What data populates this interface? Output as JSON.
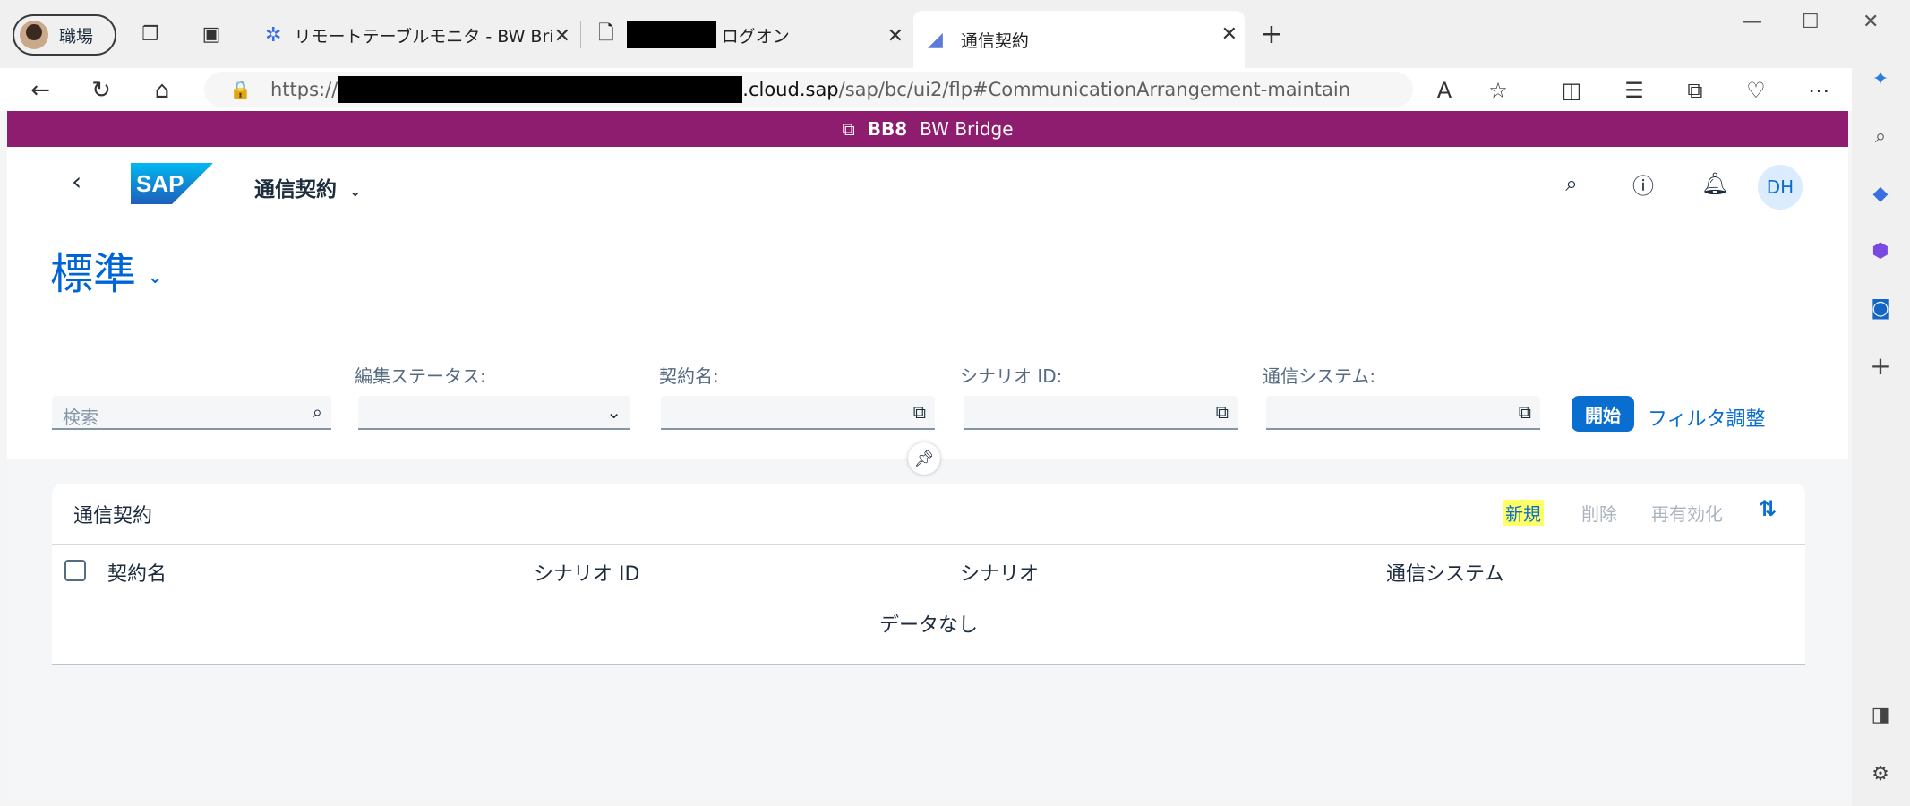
{
  "browser": {
    "profile_label": "職場",
    "tabs": [
      {
        "label": "リモートテーブルモニタ - BW Bridge (S"
      },
      {
        "label": "ログオン"
      },
      {
        "label": "通信契約"
      }
    ],
    "new_tab": "+",
    "url_prefix": "https://",
    "url_host_suffix": ".cloud.sap",
    "url_path": "/sap/bc/ui2/flp#CommunicationArrangement-maintain"
  },
  "sap": {
    "env_id": "BB8",
    "env_name": "BW Bridge",
    "app_title": "通信契約",
    "user_initials": "DH",
    "variant": "標準",
    "filters": {
      "search_placeholder": "検索",
      "edit_status_label": "編集ステータス:",
      "arrangement_name_label": "契約名:",
      "scenario_id_label": "シナリオ ID:",
      "comm_system_label": "通信システム:",
      "go_label": "開始",
      "adapt_label": "フィルタ調整"
    },
    "table": {
      "title": "通信契約",
      "actions": {
        "new": "新規",
        "delete": "削除",
        "reactivate": "再有効化"
      },
      "columns": [
        "契約名",
        "シナリオ ID",
        "シナリオ",
        "通信システム"
      ],
      "no_data": "データなし"
    }
  },
  "colors": {
    "shell_purple": "#8f1d6f",
    "accent": "#0a6ed1",
    "highlight": "#ffff66"
  },
  "icons": [
    "back-arrow-icon",
    "refresh-icon",
    "home-icon",
    "lock-icon",
    "read-aloud-icon",
    "favorite-icon",
    "split-screen-icon",
    "favorites-list-icon",
    "collections-icon",
    "health-icon",
    "more-icon",
    "copilot-icon",
    "search-icon",
    "help-icon",
    "bell-icon",
    "value-help-icon",
    "chevron-down-icon",
    "pin-icon",
    "sort-icon",
    "settings-icon"
  ]
}
